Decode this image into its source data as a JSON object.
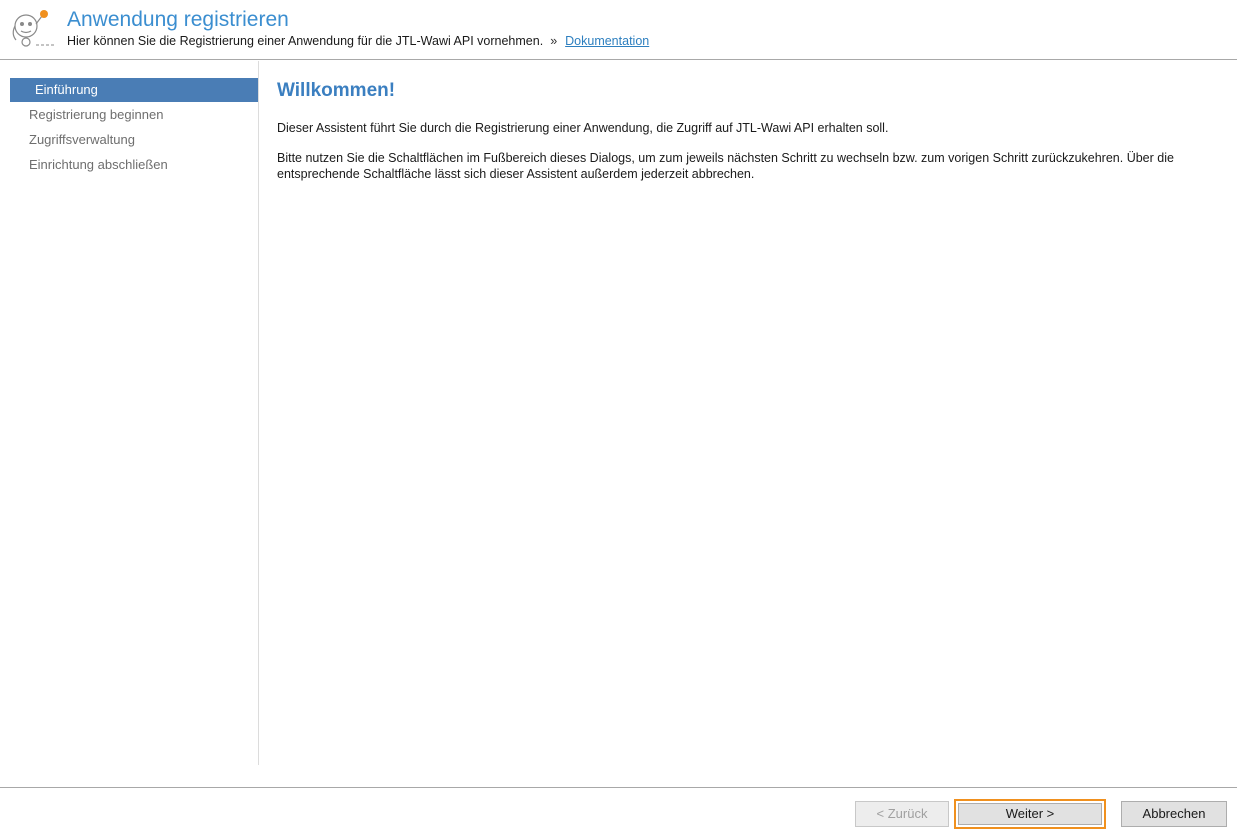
{
  "header": {
    "title": "Anwendung registrieren",
    "subtitle": "Hier können Sie die Registrierung einer Anwendung für die JTL-Wawi API vornehmen.",
    "separator": "»",
    "doc_link": "Dokumentation"
  },
  "sidebar": {
    "items": [
      {
        "label": "Einführung",
        "active": true
      },
      {
        "label": "Registrierung beginnen",
        "active": false
      },
      {
        "label": "Zugriffsverwaltung",
        "active": false
      },
      {
        "label": "Einrichtung abschließen",
        "active": false
      }
    ]
  },
  "content": {
    "heading": "Willkommen!",
    "paragraph1": "Dieser Assistent führt Sie durch die Registrierung einer Anwendung, die Zugriff auf JTL-Wawi API erhalten soll.",
    "paragraph2": "Bitte nutzen Sie die Schaltflächen im Fußbereich dieses Dialogs, um zum jeweils nächsten Schritt zu wechseln bzw. zum vorigen Schritt zurückzukehren. Über die entsprechende Schaltfläche lässt sich dieser Assistent außerdem jederzeit abbrechen."
  },
  "footer": {
    "back_label": "< Zurück",
    "next_label": "Weiter >",
    "cancel_label": "Abbrechen"
  },
  "colors": {
    "accent": "#3b8ed0",
    "active_nav": "#4a7db5",
    "highlight": "#f0901e"
  }
}
